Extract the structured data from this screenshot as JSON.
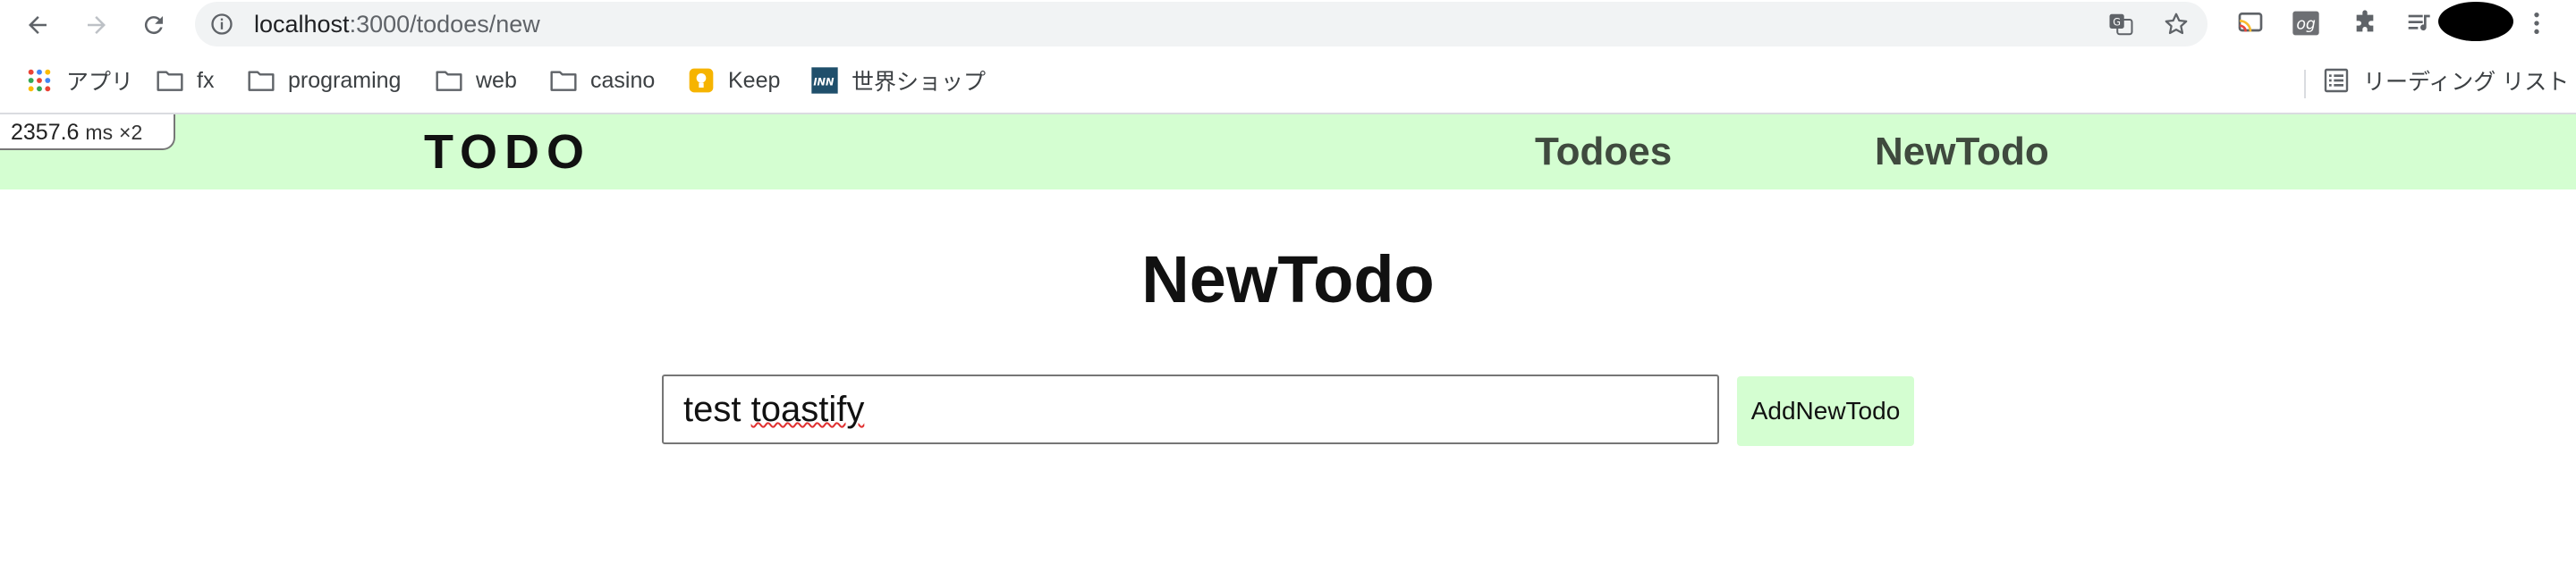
{
  "browser": {
    "url_host": "localhost",
    "url_path": ":3000/todoes/new"
  },
  "bookmarks": {
    "items": [
      {
        "label": "アプリ",
        "icon": "apps-grid-icon"
      },
      {
        "label": "fx",
        "icon": "folder-icon"
      },
      {
        "label": "programing",
        "icon": "folder-icon"
      },
      {
        "label": "web",
        "icon": "folder-icon"
      },
      {
        "label": "casino",
        "icon": "folder-icon"
      },
      {
        "label": "Keep",
        "icon": "keep-icon"
      },
      {
        "label": "世界ショップ",
        "icon": "inn-icon"
      }
    ],
    "reading_list": "リーディング リスト"
  },
  "perf": {
    "value": "2357.6",
    "unit": "ms",
    "multiplier": "×2"
  },
  "header": {
    "logo": "TODO",
    "nav": [
      "Todoes",
      "NewTodo"
    ]
  },
  "main": {
    "title": "NewTodo",
    "input_value_1": "test ",
    "input_value_2": "toastify",
    "button_label": "AddNewTodo"
  },
  "colors": {
    "accent": "#d4fed1",
    "nav_text": "#3f4a3e"
  }
}
